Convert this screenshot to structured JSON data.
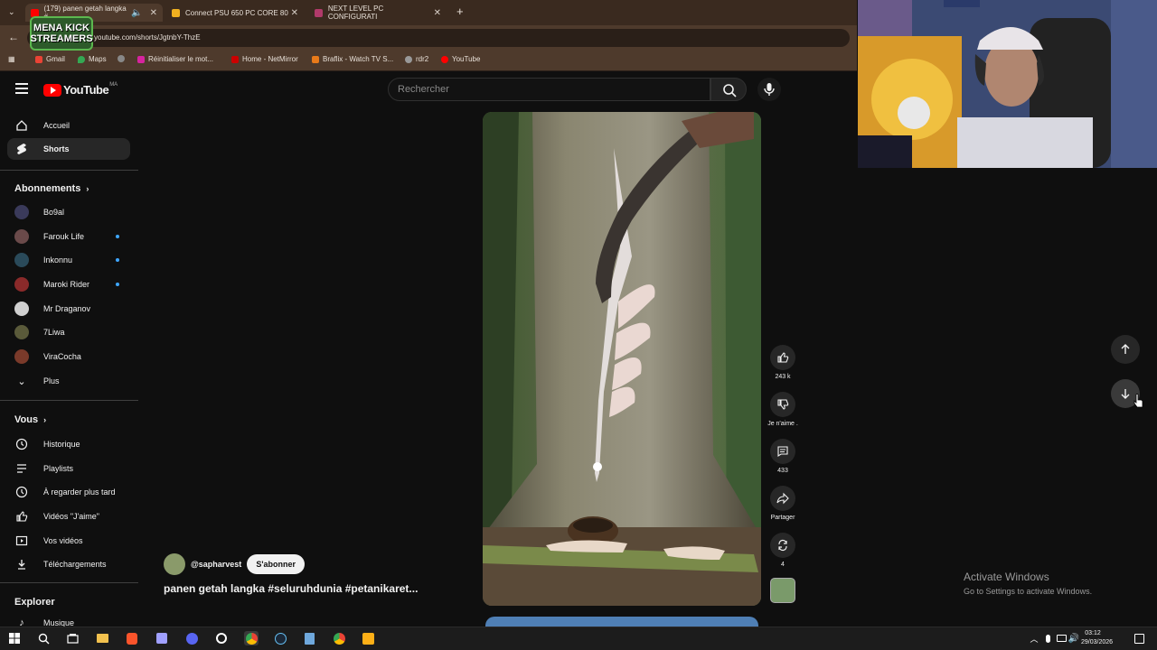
{
  "browser": {
    "tabs": [
      {
        "label": "(179) panen getah langka #",
        "active": true,
        "favicon_color": "#ff0000"
      },
      {
        "label": "Connect PSU 650 PC CORE 80",
        "active": false,
        "favicon_color": "#f0b020"
      },
      {
        "label": "NEXT LEVEL PC CONFIGURATI",
        "active": false,
        "favicon_color": "#b03a6a"
      }
    ],
    "url": "youtube.com/shorts/JgtnbY-ThzE",
    "bookmarks": [
      "Gmail",
      "Maps",
      "",
      "Réinitialiser le mot...",
      "Home - NetMirror",
      "Braflix - Watch TV S...",
      "rdr2",
      "YouTube"
    ],
    "overlay_logo": "MENA KICK STREAMERS"
  },
  "youtube": {
    "logo_text": "YouTube",
    "region": "MA",
    "search_placeholder": "Rechercher"
  },
  "sidebar": {
    "main": [
      {
        "label": "Accueil",
        "icon": "home-icon"
      },
      {
        "label": "Shorts",
        "icon": "shorts-icon",
        "active": true
      }
    ],
    "subscriptions_header": "Abonnements",
    "subscriptions": [
      {
        "label": "Bo9al",
        "avatar_color": "#3a3a5a",
        "new": false
      },
      {
        "label": "Farouk Life",
        "avatar_color": "#6a4a4a",
        "new": true
      },
      {
        "label": "Inkonnu",
        "avatar_color": "#2a4a5a",
        "new": true
      },
      {
        "label": "Maroki Rider",
        "avatar_color": "#8a2a2a",
        "new": true
      },
      {
        "label": "Mr Draganov",
        "avatar_color": "#d0d0d0",
        "new": false
      },
      {
        "label": "7Liwa",
        "avatar_color": "#5a5a3a",
        "new": false
      },
      {
        "label": "ViraCocha",
        "avatar_color": "#7a3a2a",
        "new": false
      }
    ],
    "more_label": "Plus",
    "you_header": "Vous",
    "you_items": [
      {
        "label": "Historique",
        "icon": "history-icon"
      },
      {
        "label": "Playlists",
        "icon": "playlists-icon"
      },
      {
        "label": "À regarder plus tard",
        "icon": "watch-later-icon"
      },
      {
        "label": "Vidéos \"J'aime\"",
        "icon": "liked-icon"
      },
      {
        "label": "Vos vidéos",
        "icon": "your-videos-icon"
      },
      {
        "label": "Téléchargements",
        "icon": "downloads-icon"
      }
    ],
    "explore_header": "Explorer",
    "explore_items": [
      {
        "label": "Musique",
        "icon": "music-icon"
      }
    ]
  },
  "short": {
    "channel": "@sapharvest",
    "subscribe_label": "S'abonner",
    "title": "panen getah langka #seluruhdunia #petanikaret...",
    "actions": [
      {
        "icon": "like-icon",
        "label": "243 k"
      },
      {
        "icon": "dislike-icon",
        "label": "Je n'aime ."
      },
      {
        "icon": "comment-icon",
        "label": "433"
      },
      {
        "icon": "share-icon",
        "label": "Partager"
      },
      {
        "icon": "remix-icon",
        "label": "4"
      }
    ]
  },
  "windows": {
    "activate_title": "Activate Windows",
    "activate_sub": "Go to Settings to activate Windows.",
    "time": "03:12",
    "date": "29/03/2026"
  }
}
